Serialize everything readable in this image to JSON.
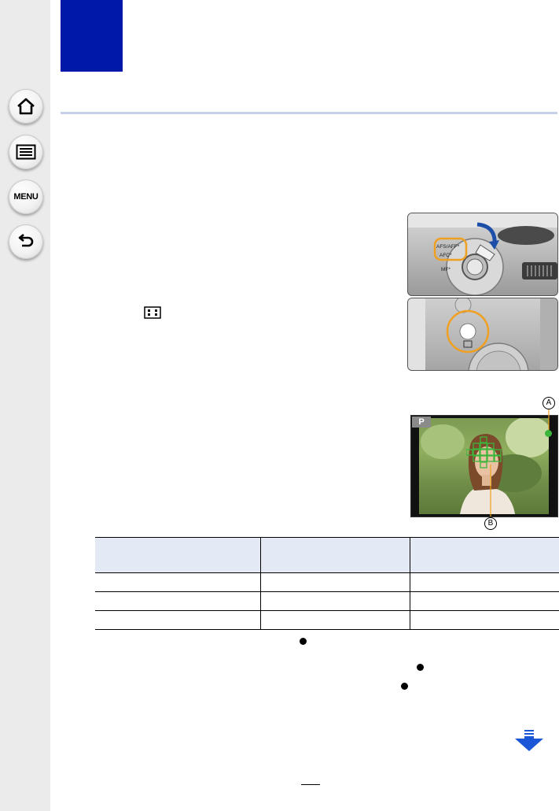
{
  "sidebar": {
    "home_label": "Home",
    "contents_label": "Contents",
    "menu_label": "MENU",
    "back_label": "Back"
  },
  "colors": {
    "chapter_block": "#0018a8",
    "rule": "#c5d0ea",
    "table_header": "#e4e9f6",
    "focus_ring": "#f0a020",
    "af_frame": "#3db53d",
    "next_arrow": "#1a56d6"
  },
  "figures": {
    "dial_labels": [
      "AFS/AFF*",
      "AFC*",
      "MF*"
    ],
    "lcd_mode": "P",
    "callout_a": "A",
    "callout_b": "B"
  },
  "af_table": {
    "headers": [
      "",
      "",
      ""
    ],
    "rows": [
      [
        "",
        "",
        ""
      ],
      [
        "",
        "",
        ""
      ],
      [
        "",
        "",
        ""
      ]
    ]
  },
  "icons": {
    "home": "home-icon",
    "contents": "list-icon",
    "back": "return-icon",
    "next": "next-page-arrow-icon",
    "af_mode": "af-mode-icon"
  }
}
